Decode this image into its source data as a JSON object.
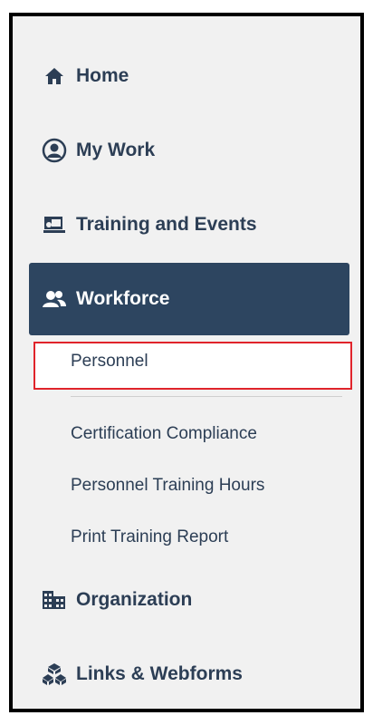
{
  "nav": {
    "home": "Home",
    "my_work": "My Work",
    "training_events": "Training and Events",
    "workforce": "Workforce",
    "organization": "Organization",
    "links_webforms": "Links & Webforms"
  },
  "workforce_sub": {
    "personnel": "Personnel",
    "certification_compliance": "Certification Compliance",
    "personnel_training_hours": "Personnel Training Hours",
    "print_training_report": "Print Training Report"
  },
  "colors": {
    "active_bg": "#2d4560",
    "text": "#2c3e55",
    "highlight_border": "#e0242b"
  },
  "icons": [
    "home-icon",
    "user-circle-icon",
    "training-icon",
    "users-icon",
    "building-icon",
    "cubes-icon"
  ]
}
